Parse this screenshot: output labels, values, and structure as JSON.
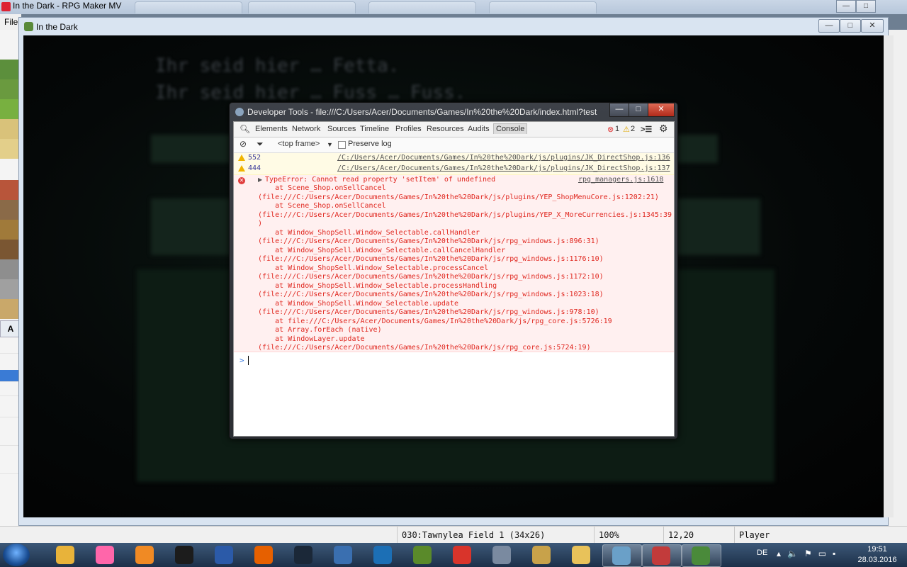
{
  "app": {
    "title": "In the Dark - RPG Maker MV",
    "menu_file": "File",
    "palette_tab": "A"
  },
  "game_window": {
    "title": "In the Dark",
    "controls": {
      "minimize": "—",
      "maximize": "□",
      "close": "✕"
    },
    "blurred_text": [
      "Ihr seid hier … Fetta.",
      "Ihr seid hier … Fuss … Fuss."
    ]
  },
  "devtools": {
    "title": "Developer Tools - file:///C:/Users/Acer/Documents/Games/In%20the%20Dark/index.html?test",
    "tabs": [
      "Elements",
      "Network",
      "Sources",
      "Timeline",
      "Profiles",
      "Resources",
      "Audits",
      "Console"
    ],
    "active_tab": "Console",
    "error_count": "1",
    "warning_count": "2",
    "toolbar": {
      "frame_select": "<top frame>",
      "preserve_log": "Preserve log"
    },
    "warnings": [
      {
        "count": "552",
        "source": "/C:/Users/Acer/Documents/Games/In%20the%20Dark/js/plugins/JK_DirectShop.js:136"
      },
      {
        "count": "444",
        "source": "/C:/Users/Acer/Documents/Games/In%20the%20Dark/js/plugins/JK_DirectShop.js:137"
      }
    ],
    "error": {
      "message": "TypeError: Cannot read property 'setItem' of undefined",
      "source": "rpg_managers.js:1618",
      "stack": [
        "    at Scene_Shop.onSellCancel",
        "(file:///C:/Users/Acer/Documents/Games/In%20the%20Dark/js/plugins/YEP_ShopMenuCore.js:1202:21)",
        "    at Scene_Shop.onSellCancel",
        "(file:///C:/Users/Acer/Documents/Games/In%20the%20Dark/js/plugins/YEP_X_MoreCurrencies.js:1345:39",
        ")",
        "    at Window_ShopSell.Window_Selectable.callHandler",
        "(file:///C:/Users/Acer/Documents/Games/In%20the%20Dark/js/rpg_windows.js:896:31)",
        "    at Window_ShopSell.Window_Selectable.callCancelHandler",
        "(file:///C:/Users/Acer/Documents/Games/In%20the%20Dark/js/rpg_windows.js:1176:10)",
        "    at Window_ShopSell.Window_Selectable.processCancel",
        "(file:///C:/Users/Acer/Documents/Games/In%20the%20Dark/js/rpg_windows.js:1172:10)",
        "    at Window_ShopSell.Window_Selectable.processHandling",
        "(file:///C:/Users/Acer/Documents/Games/In%20the%20Dark/js/rpg_windows.js:1023:18)",
        "    at Window_ShopSell.Window_Selectable.update",
        "(file:///C:/Users/Acer/Documents/Games/In%20the%20Dark/js/rpg_windows.js:978:10)",
        "    at file:///C:/Users/Acer/Documents/Games/In%20the%20Dark/js/rpg_core.js:5726:19",
        "    at Array.forEach (native)",
        "    at WindowLayer.update",
        "(file:///C:/Users/Acer/Documents/Games/In%20the%20Dark/js/rpg_core.js:5724:19)"
      ]
    },
    "prompt": ">"
  },
  "statusbar": {
    "map": "030:Tawnylea Field 1 (34x26)",
    "zoom": "100%",
    "coords": "12,20",
    "mode": "Player"
  },
  "taskbar": {
    "apps": [
      {
        "icon": "chrome-icon",
        "color": "#e8b33a"
      },
      {
        "icon": "osu-icon",
        "color": "#ff66aa"
      },
      {
        "icon": "media-player-icon",
        "color": "#f08a24"
      },
      {
        "icon": "razer-icon",
        "color": "#1c1c1c"
      },
      {
        "icon": "visual-studio-icon",
        "color": "#2b5aa8"
      },
      {
        "icon": "firefox-icon",
        "color": "#e66000"
      },
      {
        "icon": "steam-icon",
        "color": "#1b2838"
      },
      {
        "icon": "notepad-icon",
        "color": "#3a6fb0"
      },
      {
        "icon": "app-icon",
        "color": "#1c6fb5"
      },
      {
        "icon": "minecraft-icon",
        "color": "#5a8a2a"
      },
      {
        "icon": "pdf-icon",
        "color": "#d9342b"
      },
      {
        "icon": "pinned-icon",
        "color": "#7a8aa0"
      },
      {
        "icon": "league-icon",
        "color": "#c8a24a"
      },
      {
        "icon": "explorer-icon",
        "color": "#e8c25a"
      },
      {
        "icon": "tablet-icon",
        "color": "#6aa0c8"
      },
      {
        "icon": "rpgmaker-icon",
        "color": "#c23b3b"
      },
      {
        "icon": "game-icon",
        "color": "#4a8a3a"
      }
    ],
    "language": "DE",
    "time": "19:51",
    "date": "28.03.2016"
  }
}
